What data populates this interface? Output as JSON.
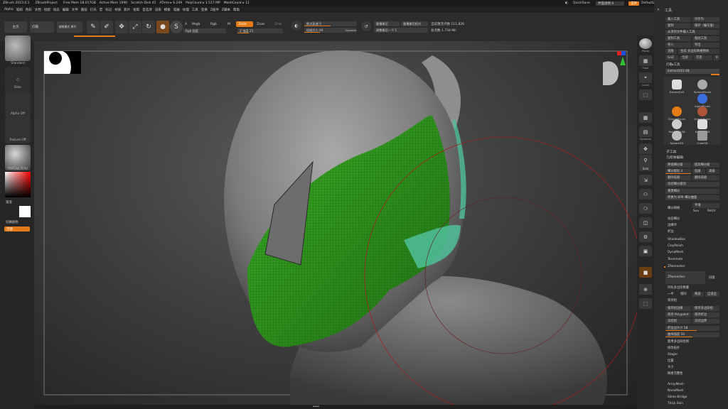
{
  "titlebar": {
    "app": "ZBrush 2023.0.1",
    "project": "ZBrushProject",
    "stats": [
      "Free Mem 18.017GB",
      "Active Mem 1090",
      "Scratch Disk 45",
      "ATime ▸ 6.249",
      "PolyCount ▸ 1.517 MP",
      "MeshCount ▸ 11"
    ],
    "quicksave": "QuickSave",
    "transparency": "界面透明 0",
    "menu_btn": "菜单",
    "script": "DefaultZScript"
  },
  "menubar": [
    "Alpha",
    "笔刷",
    "色彩",
    "文档",
    "绘图",
    "动态",
    "编辑",
    "文件",
    "图层",
    "灯光",
    "宏",
    "标记",
    "材质",
    "影片",
    "拾取",
    "首选项",
    "渲染",
    "模板",
    "笔触",
    "纹理",
    "工具",
    "变换",
    "Z插件",
    "Z脚本",
    "帮助"
  ],
  "toolbar": {
    "home": "主页",
    "lightbox": "灯箱",
    "quick_sketch": "蜡笔模式 调节",
    "edit": "Edit",
    "draw": "Draw",
    "move": "Move",
    "scale": "Scale",
    "rotate": "Rotate",
    "a_label": "A",
    "mrgb": "Mrgb",
    "rgb": "Rgb",
    "m": "M",
    "zadd": "Zadd",
    "zsub": "Zsub",
    "zcut": "Zcut",
    "rgb_intensity": "Rgb 强度",
    "z_intensity": "Z 强度 25",
    "focal_shift": "焦点衰减 0",
    "draw_size": "绘制大小 64",
    "dynamic": "Dynamic",
    "replay_last": "重播最后",
    "replay_last_rel": "重播最后相对",
    "mirror_last": "调整最后一个 1",
    "active_points": "当前激活点数 111,826",
    "total_points": "总点数 1.734 Mil"
  },
  "leftpanel": {
    "brush": "Standard",
    "stroke": "Dots",
    "alpha": "Alpha Off",
    "texture": "Texture Off",
    "material": "MatCap Gray",
    "gradient": "渐变",
    "switch_color": "切换颜色",
    "alternate": "交替"
  },
  "righttools": [
    "Persp",
    "Floor",
    "Local",
    "Frame",
    "Move",
    "Scale",
    "Rotate",
    "Transp",
    "Solo",
    "Dynamic",
    "Xpose",
    "PolyF",
    "Gizmo",
    "Line Fill"
  ],
  "tray": {
    "title": "工具",
    "buttons": [
      [
        "载入工具",
        "另存为"
      ],
      [
        "复制",
        "保存（编号复）"
      ],
      [
        "从项目文件载入工具",
        ""
      ],
      [
        "复制工具",
        "粘贴工具"
      ],
      [
        "导入",
        "导出"
      ],
      [
        "克隆",
        "生成 多边形网格物体"
      ],
      [
        "GoZ",
        "全部",
        "可见",
        "R"
      ]
    ],
    "lightbox_tools": "灯箱▸工具",
    "current_tool": "Extract243  48",
    "brushes": [
      "Extract243",
      "SphereBrush",
      "AlphaBrush",
      "SimpleBrush",
      "EraserBrush",
      "PolyMesh3D",
      "Extract243",
      "Sphere3D",
      "Cube3D"
    ],
    "subtool": "子工具",
    "geometry": "几何体编辑",
    "geo_rows": [
      [
        "降低细分级",
        "提高细分级"
      ],
      [
        "细分级别 3",
        "低级",
        "高级"
      ],
      [
        "删除低级",
        "删除高级"
      ],
      [
        "冻结细分级别",
        ""
      ],
      [
        "重建细分",
        ""
      ],
      [
        "转换为 BPR 细分曲面",
        ""
      ]
    ],
    "divide_label": "细分网格",
    "divide": "平滑",
    "suv": "Suv",
    "rsmooth": "ReUV",
    "geo_items": [
      "动态细分",
      "边缘环",
      "折边",
      "ShadowBox",
      "ClayPolish",
      "DynaMesh",
      "Tessimate",
      "ZRemesher"
    ],
    "zremesher_btn": "ZRemesher",
    "legacy": "旧版",
    "freeze_borders": "目标多边形数量",
    "half": "一半",
    "same": "相同",
    "double": "两倍",
    "adapt": "自适应",
    "keep_groups": "保持组",
    "groups_rows": [
      [
        "保持组边缘",
        "保持多边形组"
      ],
      [
        "保持 Polypaint",
        "保持折边"
      ],
      [
        "冻结组",
        "冻结边界"
      ]
    ],
    "slider1": "折边边大小 58",
    "slider2": "曲线强度 50",
    "lower_rows": [
      "修改拓扑",
      "位置",
      "大小",
      "网格完整性"
    ],
    "bottom_items": [
      "ArrayMesh",
      "NanoMesh",
      "Slime Bridge",
      "Thick Skin"
    ]
  },
  "colors": {
    "accent": "#e47b16",
    "mask_green": "#3fa52a",
    "teal": "#4fbf9a"
  }
}
